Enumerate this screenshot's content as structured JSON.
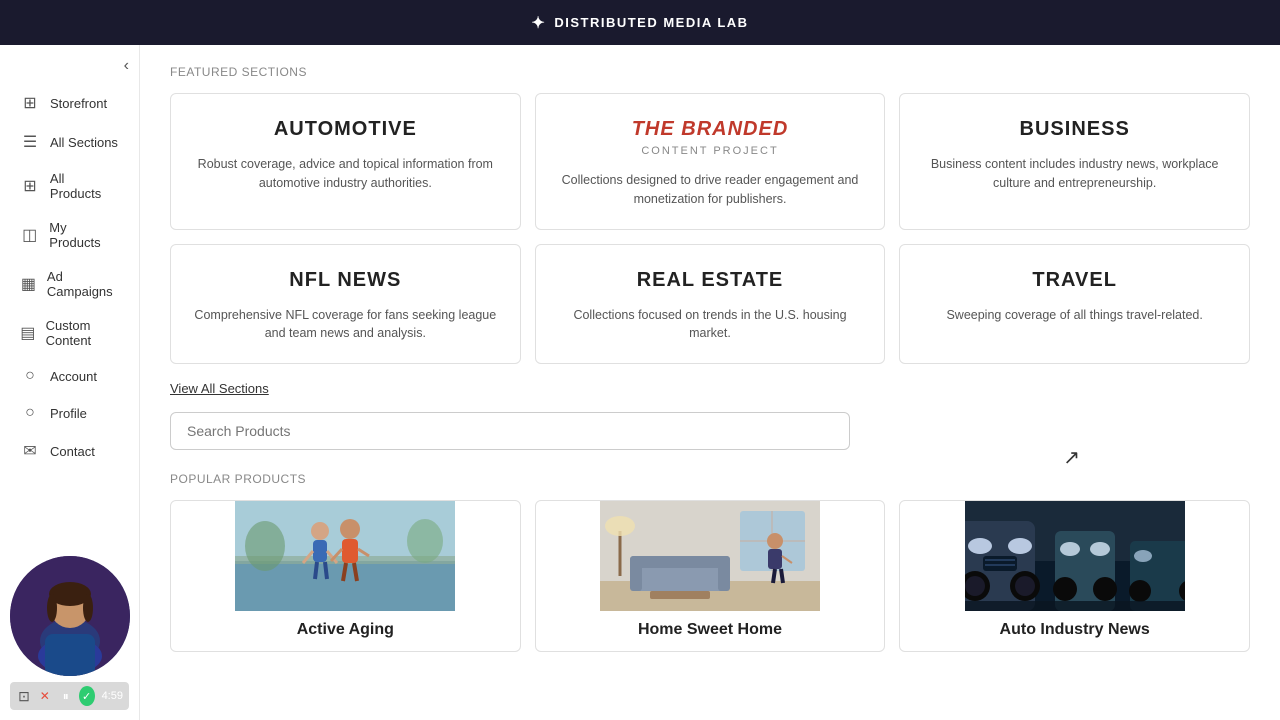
{
  "topbar": {
    "logo_icon": "✦",
    "title": "DISTRIBUTED MEDIA LAB"
  },
  "sidebar": {
    "collapse_label": "‹",
    "items": [
      {
        "id": "storefront",
        "label": "Storefront",
        "icon": "⊞"
      },
      {
        "id": "all-sections",
        "label": "All Sections",
        "icon": "☰"
      },
      {
        "id": "all-products",
        "label": "All Products",
        "icon": "⊞"
      },
      {
        "id": "my-products",
        "label": "My Products",
        "icon": "◫"
      },
      {
        "id": "ad-campaigns",
        "label": "Ad Campaigns",
        "icon": "▦"
      },
      {
        "id": "custom-content",
        "label": "Custom Content",
        "icon": "▤"
      },
      {
        "id": "account",
        "label": "Account",
        "icon": "○"
      },
      {
        "id": "profile",
        "label": "Profile",
        "icon": "○"
      },
      {
        "id": "contact",
        "label": "Contact",
        "icon": "✉"
      }
    ]
  },
  "control_bar": {
    "stop_icon": "×",
    "pause_icon": "⏸",
    "check_icon": "✓",
    "time": "4:59"
  },
  "main": {
    "featured_heading": "Featured Sections",
    "featured_cards": [
      {
        "id": "automotive",
        "title": "AUTOMOTIVE",
        "branded": false,
        "desc": "Robust coverage, advice and topical information from automotive industry authorities."
      },
      {
        "id": "branded-content",
        "title": "THE BRANDED",
        "subtitle": "Content Project",
        "branded": true,
        "desc": "Collections designed to drive reader engagement and monetization for publishers."
      },
      {
        "id": "business",
        "title": "BUSINESS",
        "branded": false,
        "desc": "Business content includes industry news, workplace culture and entrepreneurship."
      },
      {
        "id": "nfl-news",
        "title": "NFL NEWS",
        "branded": false,
        "desc": "Comprehensive NFL coverage for fans seeking league and team news and analysis."
      },
      {
        "id": "real-estate",
        "title": "REAL ESTATE",
        "branded": false,
        "desc": "Collections focused on trends in the U.S. housing market."
      },
      {
        "id": "travel",
        "title": "TRAVEL",
        "branded": false,
        "desc": "Sweeping coverage of all things travel-related."
      }
    ],
    "view_all_label": "View All Sections",
    "search_placeholder": "Search Products",
    "popular_heading": "Popular Products",
    "popular_products": [
      {
        "id": "active-aging",
        "title": "Active Aging",
        "image_desc": "elderly couple jogging outdoors",
        "bg1": "#7a9eb5",
        "bg2": "#5b8c7a"
      },
      {
        "id": "home-sweet-home",
        "title": "Home Sweet Home",
        "image_desc": "interior living room design",
        "bg1": "#c8c4b8",
        "bg2": "#9e9a8e"
      },
      {
        "id": "auto-industry-news",
        "title": "Auto Industry News",
        "image_desc": "row of cars close up",
        "bg1": "#2a3a4a",
        "bg2": "#1a2a3a"
      }
    ]
  }
}
